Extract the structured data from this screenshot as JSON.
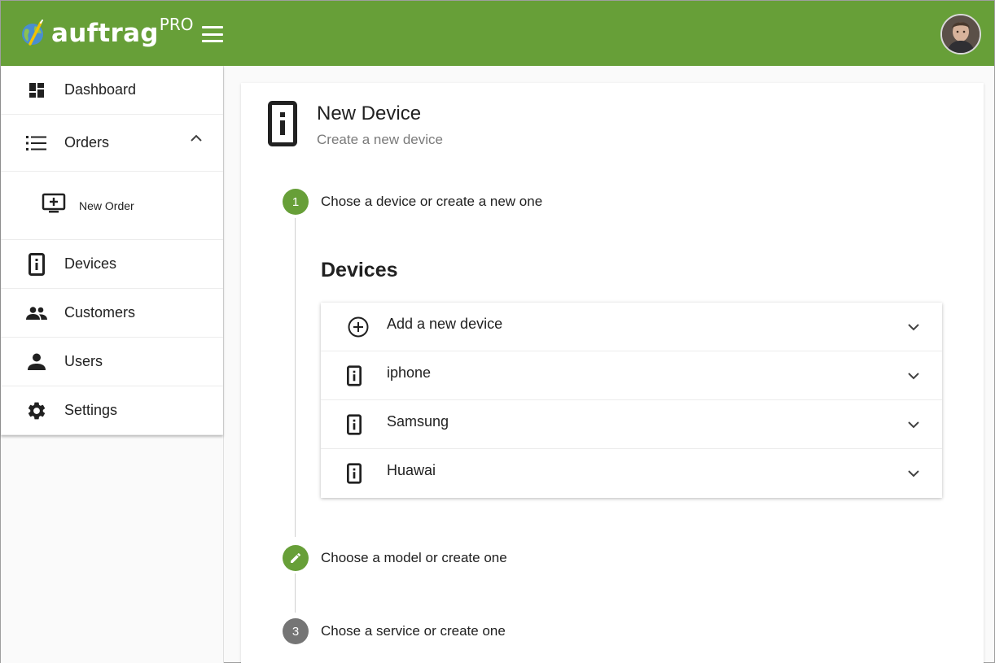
{
  "app": {
    "logo_text": "auftrag",
    "logo_sup": "PRO"
  },
  "sidebar": {
    "items": [
      {
        "label": "Dashboard",
        "icon": "dashboard-icon"
      },
      {
        "label": "Orders",
        "icon": "list-icon",
        "expanded": true,
        "children": [
          {
            "label": "New Order",
            "icon": "add-to-queue-icon"
          }
        ]
      },
      {
        "label": "Devices",
        "icon": "device-info-icon"
      },
      {
        "label": "Customers",
        "icon": "people-icon"
      },
      {
        "label": "Users",
        "icon": "person-icon"
      },
      {
        "label": "Settings",
        "icon": "gear-icon"
      }
    ]
  },
  "page": {
    "title": "New Device",
    "subtitle": "Create a new device"
  },
  "stepper": {
    "steps": [
      {
        "number": "1",
        "label": "Chose a device or create a new one",
        "state": "active",
        "color": "#679f38"
      },
      {
        "number": "",
        "label": "Choose a model or create one",
        "state": "editable",
        "color": "#679f38"
      },
      {
        "number": "3",
        "label": "Chose a service or create one",
        "state": "inactive",
        "color": "#757575"
      }
    ]
  },
  "devices_section": {
    "title": "Devices",
    "panels": [
      {
        "label": "Add a new device",
        "icon": "add-circle-icon"
      },
      {
        "label": "iphone",
        "icon": "device-info-icon"
      },
      {
        "label": "Samsung",
        "icon": "device-info-icon"
      },
      {
        "label": "Huawai",
        "icon": "device-info-icon"
      }
    ]
  },
  "colors": {
    "brand": "#679f38",
    "inactive_step": "#757575"
  }
}
